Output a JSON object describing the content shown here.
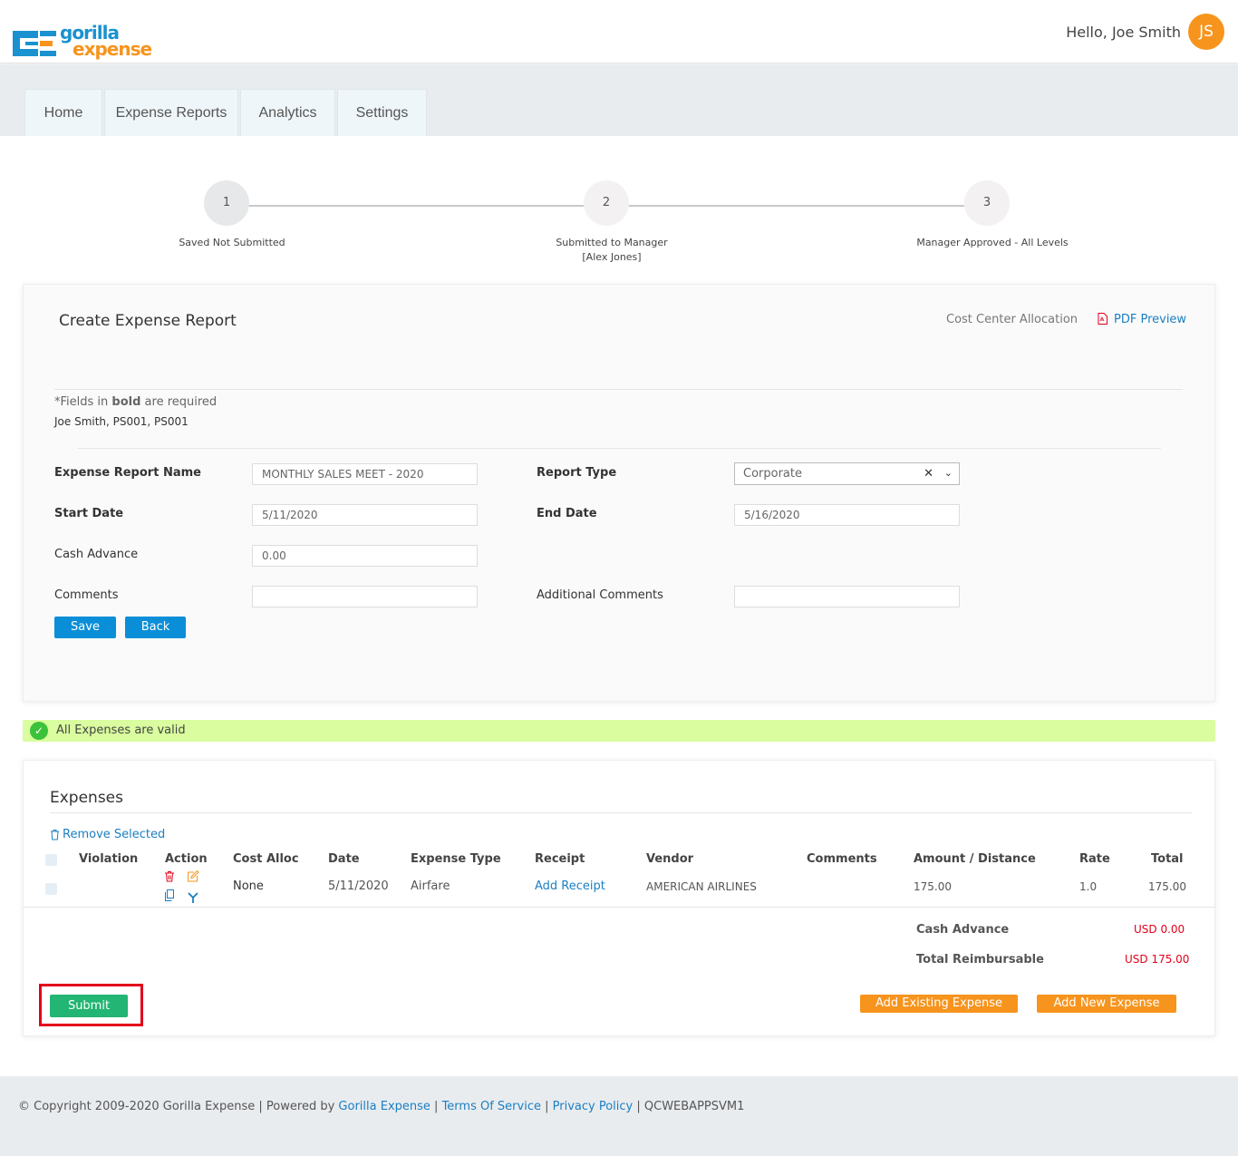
{
  "header": {
    "logo_word1": "gorilla",
    "logo_word2": "expense",
    "greeting": "Hello, Joe Smith",
    "avatar_initials": "JS"
  },
  "nav": {
    "tabs": [
      "Home",
      "Expense Reports",
      "Analytics",
      "Settings"
    ]
  },
  "stepper": {
    "steps": [
      {
        "number": "1",
        "label": "Saved Not Submitted",
        "sublabel": ""
      },
      {
        "number": "2",
        "label": "Submitted to Manager",
        "sublabel": "[Alex Jones]"
      },
      {
        "number": "3",
        "label": "Manager Approved - All Levels",
        "sublabel": ""
      }
    ]
  },
  "report": {
    "title": "Create Expense Report",
    "cost_center_link": "Cost Center Allocation",
    "pdf_preview_link": "PDF Preview",
    "required_note_prefix": "*Fields in ",
    "required_note_bold": "bold",
    "required_note_suffix": " are required",
    "employee_line": "Joe Smith, PS001, PS001",
    "fields": {
      "name_label": "Expense Report Name",
      "name_value": "MONTHLY SALES MEET - 2020",
      "type_label": "Report Type",
      "type_value": "Corporate",
      "start_label": "Start Date",
      "start_value": "5/11/2020",
      "end_label": "End Date",
      "end_value": "5/16/2020",
      "cash_label": "Cash Advance",
      "cash_value": "0.00",
      "comments_label": "Comments",
      "comments_value": "",
      "additional_label": "Additional Comments",
      "additional_value": ""
    },
    "save_label": "Save",
    "back_label": "Back"
  },
  "validation": {
    "message": "All Expenses are valid"
  },
  "expenses": {
    "title": "Expenses",
    "remove_selected": "Remove Selected",
    "columns": [
      "Violation",
      "Action",
      "Cost Alloc",
      "Date",
      "Expense Type",
      "Receipt",
      "Vendor",
      "Comments",
      "Amount / Distance",
      "Rate",
      "Total"
    ],
    "rows": [
      {
        "violation": "",
        "cost_alloc": "None",
        "date": "5/11/2020",
        "expense_type": "Airfare",
        "receipt": "Add Receipt",
        "vendor": "AMERICAN AIRLINES",
        "comments": "",
        "amount": "175.00",
        "rate": "1.0",
        "total": "175.00"
      }
    ],
    "summary": {
      "cash_advance_label": "Cash Advance",
      "cash_advance_value": "USD 0.00",
      "total_label": "Total Reimbursable",
      "total_value": "USD 175.00"
    },
    "submit_label": "Submit",
    "add_existing_label": "Add Existing Expense",
    "add_new_label": "Add New Expense"
  },
  "footer": {
    "copyright": "Copyright 2009-2020 Gorilla Expense",
    "powered_by": "Powered by",
    "powered_link": "Gorilla Expense",
    "terms": "Terms Of Service",
    "privacy": "Privacy Policy",
    "server": "QCWEBAPPSVM1"
  },
  "colors": {
    "brand_blue": "#1b92d0",
    "brand_orange": "#f7941d",
    "primary_button": "#0b8ed8",
    "submit_green": "#22b573",
    "valid_bar": "#d9fd9f",
    "alert_red": "#e3001b"
  }
}
